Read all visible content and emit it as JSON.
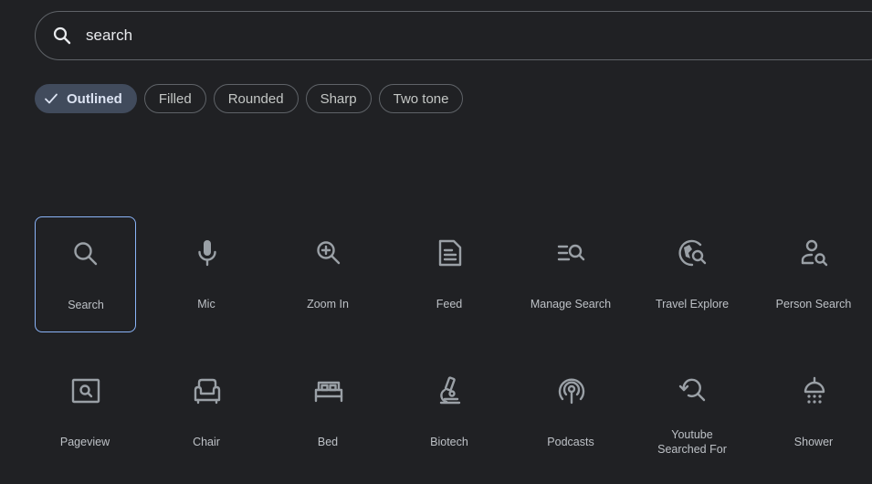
{
  "search": {
    "value": "search",
    "icon": "search-icon"
  },
  "chips": [
    {
      "label": "Outlined",
      "selected": true
    },
    {
      "label": "Filled",
      "selected": false
    },
    {
      "label": "Rounded",
      "selected": false
    },
    {
      "label": "Sharp",
      "selected": false
    },
    {
      "label": "Two tone",
      "selected": false
    }
  ],
  "icons": [
    {
      "label": "Search",
      "icon": "search-icon"
    },
    {
      "label": "Mic",
      "icon": "mic-icon"
    },
    {
      "label": "Zoom In",
      "icon": "zoom-in-icon"
    },
    {
      "label": "Feed",
      "icon": "feed-icon"
    },
    {
      "label": "Manage Search",
      "icon": "manage-search-icon"
    },
    {
      "label": "Travel Explore",
      "icon": "travel-explore-icon"
    },
    {
      "label": "Person Search",
      "icon": "person-search-icon"
    },
    {
      "label": "Pageview",
      "icon": "pageview-icon"
    },
    {
      "label": "Chair",
      "icon": "chair-icon"
    },
    {
      "label": "Bed",
      "icon": "bed-icon"
    },
    {
      "label": "Biotech",
      "icon": "biotech-icon"
    },
    {
      "label": "Podcasts",
      "icon": "podcasts-icon"
    },
    {
      "label": "Youtube Searched For",
      "icon": "youtube-searched-for-icon"
    },
    {
      "label": "Shower",
      "icon": "shower-icon"
    }
  ],
  "colors": {
    "background": "#202124",
    "icon": "#9aa0a6",
    "selected_chip": "#414b5c",
    "selected_outline": "#8ab4f8"
  }
}
